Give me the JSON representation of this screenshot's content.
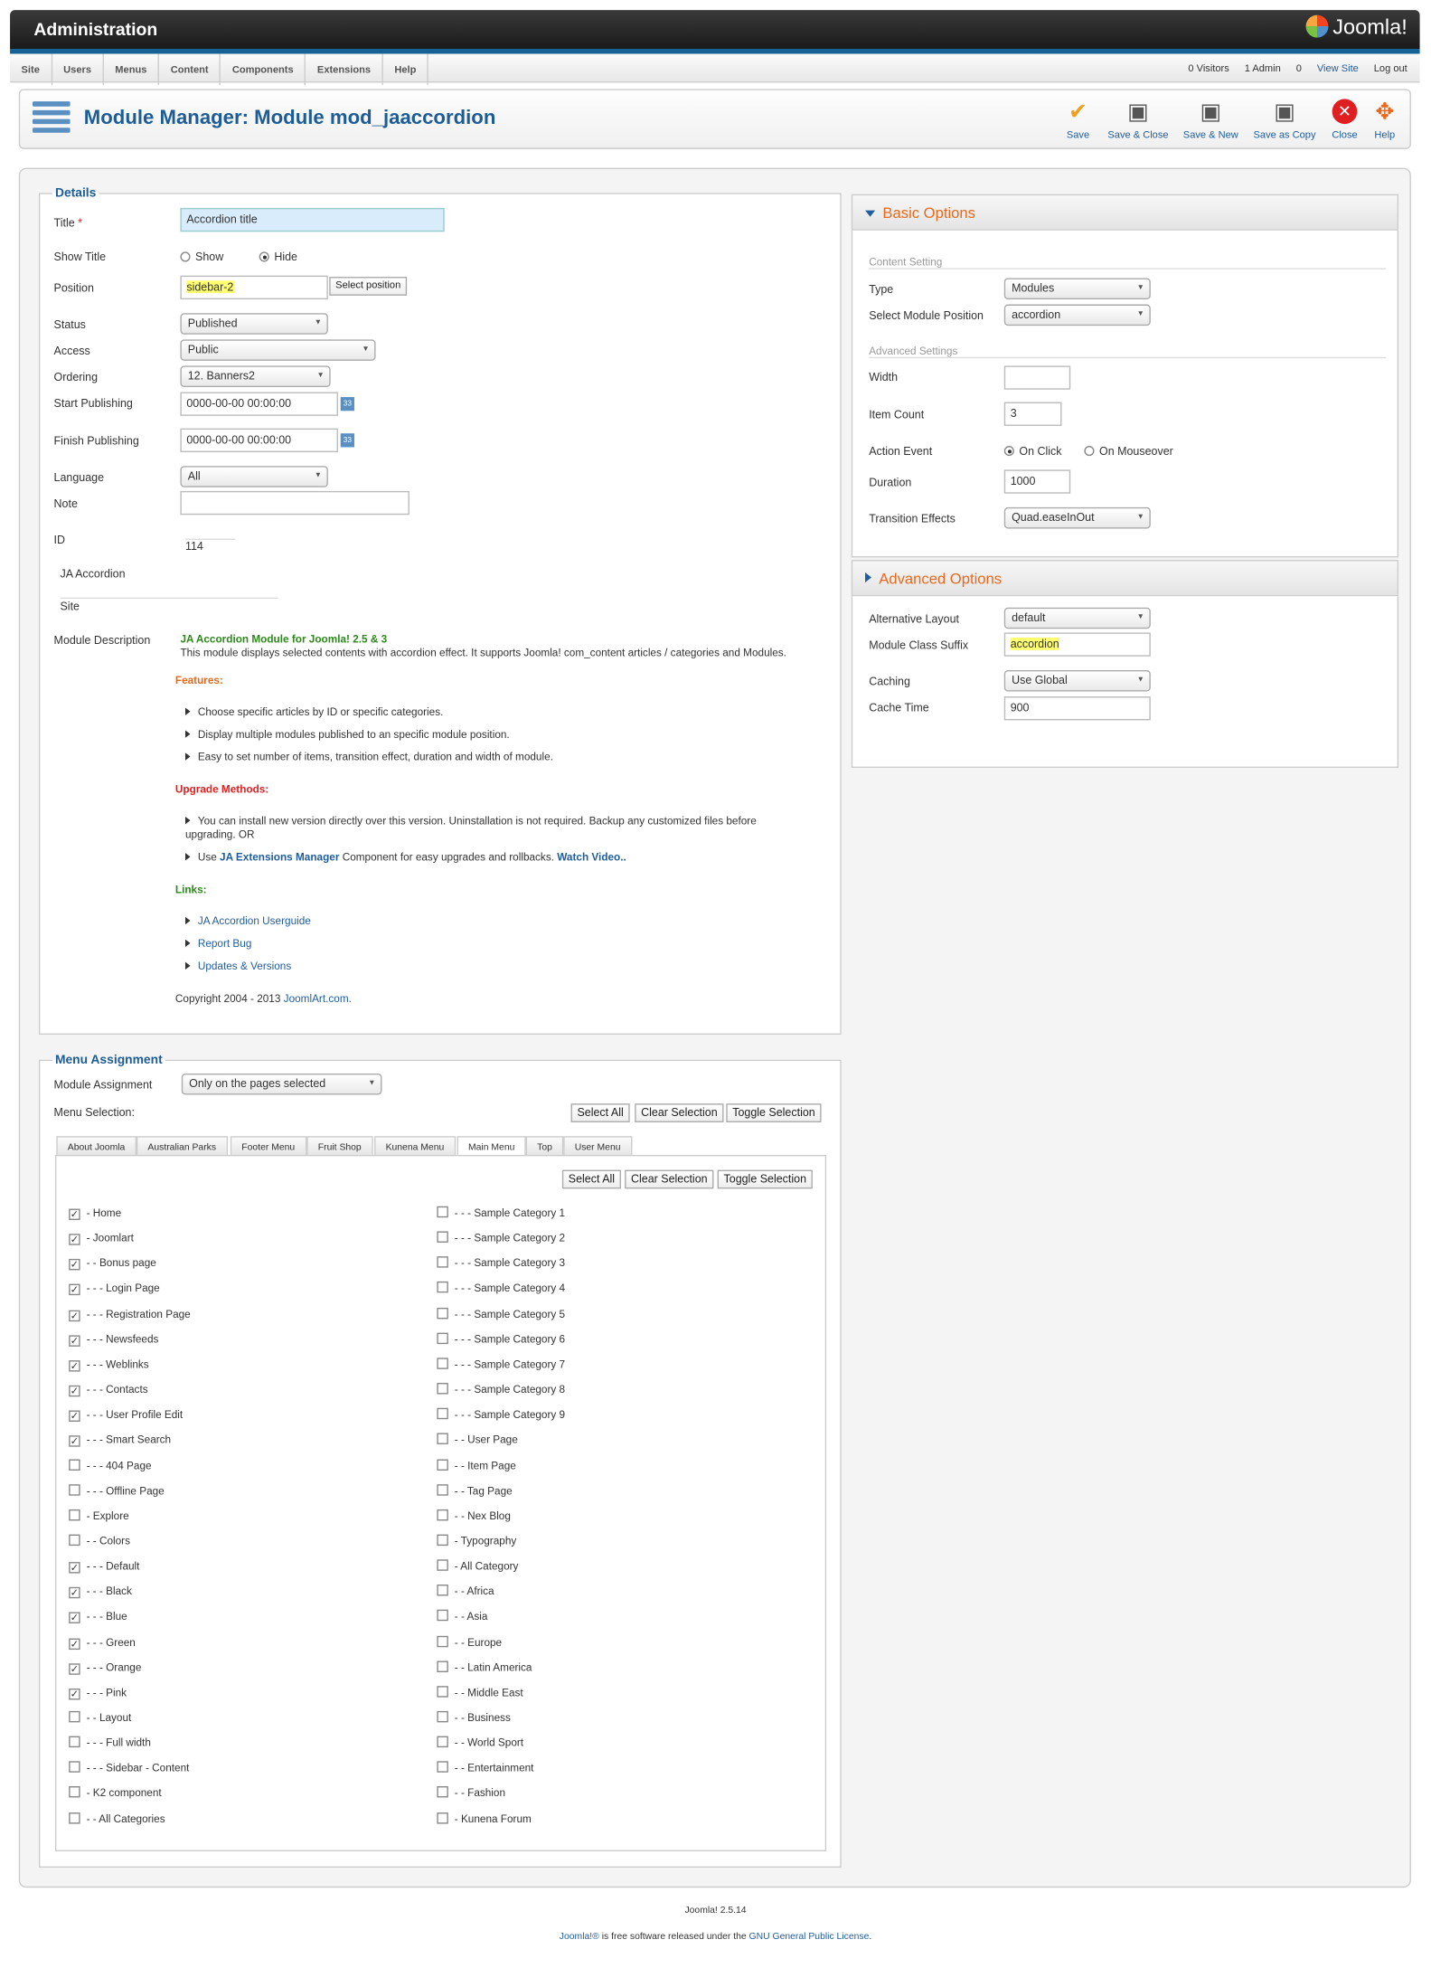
{
  "header": {
    "title": "Administration",
    "logo": "Joomla!"
  },
  "menu": [
    "Site",
    "Users",
    "Menus",
    "Content",
    "Components",
    "Extensions",
    "Help"
  ],
  "status": {
    "visitors": "0 Visitors",
    "admin": "1 Admin",
    "messages": "0",
    "view_site": "View Site",
    "logout": "Log out"
  },
  "page_title": "Module Manager: Module mod_jaaccordion",
  "toolbar": [
    "Save",
    "Save & Close",
    "Save & New",
    "Save as Copy",
    "Close",
    "Help"
  ],
  "details": {
    "legend": "Details",
    "title_label": "Title",
    "title_value": "Accordion title",
    "show_title_label": "Show Title",
    "show": "Show",
    "hide": "Hide",
    "position_label": "Position",
    "position_value": "sidebar-2",
    "select_position": "Select position",
    "status_label": "Status",
    "status_value": "Published",
    "access_label": "Access",
    "access_value": "Public",
    "ordering_label": "Ordering",
    "ordering_value": "12. Banners2",
    "start_label": "Start Publishing",
    "start_value": "0000-00-00 00:00:00",
    "finish_label": "Finish Publishing",
    "finish_value": "0000-00-00 00:00:00",
    "language_label": "Language",
    "language_value": "All",
    "note_label": "Note",
    "id_label": "ID",
    "id_value": "114",
    "module_name": "JA Accordion",
    "client": "Site",
    "desc_label": "Module Description",
    "desc_title": "JA Accordion Module for Joomla! 2.5 & 3",
    "desc_text": "This module displays selected contents with accordion effect. It supports Joomla! com_content articles / categories and Modules.",
    "features_title": "Features:",
    "features": [
      "Choose specific articles by ID or specific categories.",
      "Display multiple modules published to an specific module position.",
      "Easy to set number of items, transition effect, duration and width of module."
    ],
    "upgrade_title": "Upgrade Methods:",
    "upgrade1": "You can install new version directly over this version. Uninstallation is not required. Backup any customized files before upgrading. OR",
    "upgrade2_a": "Use ",
    "upgrade2_b": "JA Extensions Manager",
    "upgrade2_c": " Component for easy upgrades and rollbacks. ",
    "upgrade2_d": "Watch Video..",
    "links_title": "Links:",
    "links": [
      "JA Accordion Userguide",
      "Report Bug",
      "Updates & Versions"
    ],
    "copyright_a": "Copyright 2004 - 2013 ",
    "copyright_b": "JoomlArt.com."
  },
  "basic": {
    "title": "Basic Options",
    "content_setting": "Content Setting",
    "type_label": "Type",
    "type_value": "Modules",
    "smp_label": "Select Module Position",
    "smp_value": "accordion",
    "advanced_settings": "Advanced Settings",
    "width_label": "Width",
    "width_value": "",
    "item_label": "Item Count",
    "item_value": "3",
    "action_label": "Action Event",
    "on_click": "On Click",
    "on_mouseover": "On Mouseover",
    "duration_label": "Duration",
    "duration_value": "1000",
    "trans_label": "Transition Effects",
    "trans_value": "Quad.easeInOut"
  },
  "advanced": {
    "title": "Advanced Options",
    "layout_label": "Alternative Layout",
    "layout_value": "default",
    "suffix_label": "Module Class Suffix",
    "suffix_value": "accordion",
    "caching_label": "Caching",
    "caching_value": "Use Global",
    "cache_time_label": "Cache Time",
    "cache_time_value": "900"
  },
  "menu_assignment": {
    "legend": "Menu Assignment",
    "module_assignment_label": "Module Assignment",
    "module_assignment_value": "Only on the pages selected",
    "menu_selection_label": "Menu Selection:",
    "select_all": "Select All",
    "clear_selection": "Clear Selection",
    "toggle_selection": "Toggle Selection",
    "tabs": [
      "About Joomla",
      "Australian Parks",
      "Footer Menu",
      "Fruit Shop",
      "Kunena Menu",
      "Main Menu",
      "Top",
      "User Menu"
    ],
    "left_items": [
      {
        "label": "- Home",
        "checked": true
      },
      {
        "label": "- Joomlart",
        "checked": true
      },
      {
        "label": "- - Bonus page",
        "checked": true
      },
      {
        "label": "- - - Login Page",
        "checked": true
      },
      {
        "label": "- - - Registration Page",
        "checked": true
      },
      {
        "label": "- - - Newsfeeds",
        "checked": true
      },
      {
        "label": "- - - Weblinks",
        "checked": true
      },
      {
        "label": "- - - Contacts",
        "checked": true
      },
      {
        "label": "- - - User Profile Edit",
        "checked": true
      },
      {
        "label": "- - - Smart Search",
        "checked": true
      },
      {
        "label": "- - - 404 Page",
        "checked": false
      },
      {
        "label": "- - - Offline Page",
        "checked": false
      },
      {
        "label": "- Explore",
        "checked": false
      },
      {
        "label": "- - Colors",
        "checked": false
      },
      {
        "label": "- - - Default",
        "checked": true
      },
      {
        "label": "- - - Black",
        "checked": true
      },
      {
        "label": "- - - Blue",
        "checked": true
      },
      {
        "label": "- - - Green",
        "checked": true
      },
      {
        "label": "- - - Orange",
        "checked": true
      },
      {
        "label": "- - - Pink",
        "checked": true
      },
      {
        "label": "- - Layout",
        "checked": false
      },
      {
        "label": "- - - Full width",
        "checked": false
      },
      {
        "label": "- - - Sidebar - Content",
        "checked": false
      },
      {
        "label": "- K2 component",
        "checked": false
      },
      {
        "label": "- - All Categories",
        "checked": false
      }
    ],
    "right_items": [
      {
        "label": "- - - Sample Category 1",
        "checked": false
      },
      {
        "label": "- - - Sample Category 2",
        "checked": false
      },
      {
        "label": "- - - Sample Category 3",
        "checked": false
      },
      {
        "label": "- - - Sample Category 4",
        "checked": false
      },
      {
        "label": "- - - Sample Category 5",
        "checked": false
      },
      {
        "label": "- - - Sample Category 6",
        "checked": false
      },
      {
        "label": "- - - Sample Category 7",
        "checked": false
      },
      {
        "label": "- - - Sample Category 8",
        "checked": false
      },
      {
        "label": "- - - Sample Category 9",
        "checked": false
      },
      {
        "label": "- - User Page",
        "checked": false
      },
      {
        "label": "- - Item Page",
        "checked": false
      },
      {
        "label": "- - Tag Page",
        "checked": false
      },
      {
        "label": "- - Nex Blog",
        "checked": false
      },
      {
        "label": "- Typography",
        "checked": false
      },
      {
        "label": "- All Category",
        "checked": false
      },
      {
        "label": "- - Africa",
        "checked": false
      },
      {
        "label": "- - Asia",
        "checked": false
      },
      {
        "label": "- - Europe",
        "checked": false
      },
      {
        "label": "- - Latin America",
        "checked": false
      },
      {
        "label": "- - Middle East",
        "checked": false
      },
      {
        "label": "- - Business",
        "checked": false
      },
      {
        "label": "- - World Sport",
        "checked": false
      },
      {
        "label": "- - Entertainment",
        "checked": false
      },
      {
        "label": "- - Fashion",
        "checked": false
      },
      {
        "label": "- Kunena Forum",
        "checked": false
      }
    ]
  },
  "footer": {
    "version": "Joomla! 2.5.14",
    "a": "Joomla!®",
    "b": " is free software released under the ",
    "c": "GNU General Public License",
    "d": "."
  }
}
